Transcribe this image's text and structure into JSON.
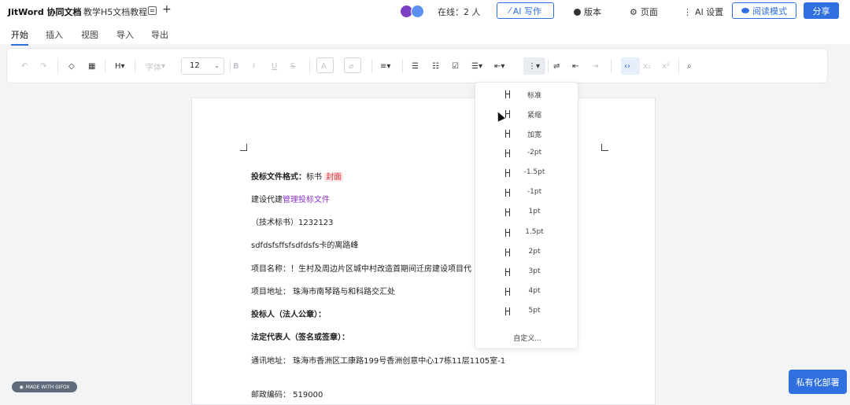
{
  "header": {
    "brand": "JitWord 协同文档",
    "doc_title": "教学H5文档教程",
    "online": "在线：2 人",
    "ai_write": "AI 写作",
    "version": "版本",
    "page": "页面",
    "ai_settings": "AI 设置",
    "read_mode": "阅读模式",
    "share": "分享"
  },
  "tabs": [
    "开始",
    "插入",
    "视图",
    "导入",
    "导出"
  ],
  "toolbar": {
    "heading": "H",
    "font_family": "字体",
    "font_size": "12"
  },
  "document": {
    "lines": [
      {
        "label": "投标文件格式：",
        "text": "标书",
        "tag": "封面"
      },
      {
        "pre": "建设代建",
        "link": "管理投标文件"
      },
      {
        "text": "（技术标书）1232123"
      },
      {
        "text": "sdfdsfsffsfsdfdsfs卡的离路峰"
      },
      {
        "text": "项目名称：！生村及周边片区城中村改造首期间迁房建设项目代"
      },
      {
        "text": "项目地址：          珠海市南琴路与和科路交汇处"
      },
      {
        "text": "投标人（法人公章）："
      },
      {
        "text": "法定代表人（签名或签章）："
      },
      {
        "text": "通讯地址：  珠海市香洲区工康路199号香洲创意中心17栋11层1105室-1"
      },
      {
        "text": "邮政编码：                  519000"
      }
    ]
  },
  "line_spacing_menu": {
    "items": [
      "标准",
      "紧缩",
      "加宽",
      "-2pt",
      "-1.5pt",
      "-1pt",
      "1pt",
      "1.5pt",
      "2pt",
      "3pt",
      "4pt",
      "5pt"
    ],
    "custom": "自定义..."
  },
  "badge": "MADE WITH GIFOX",
  "private_deploy": "私有化部署"
}
